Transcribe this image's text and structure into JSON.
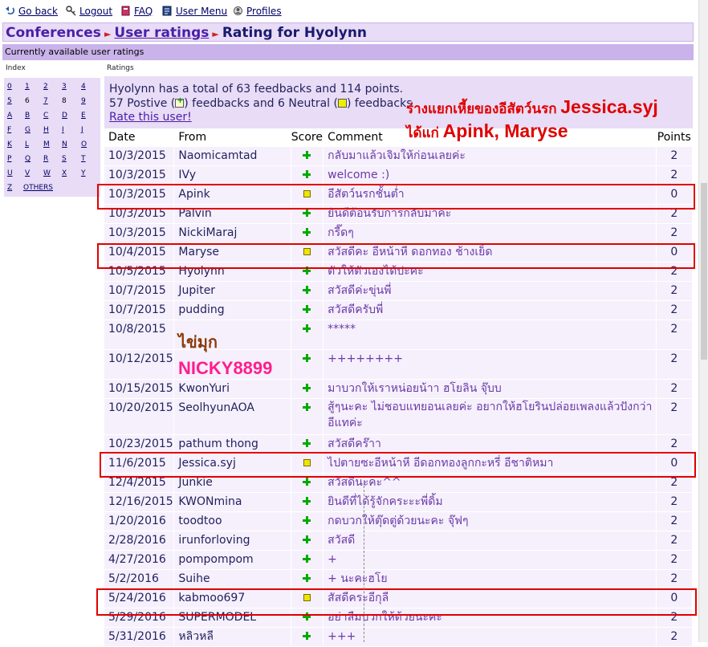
{
  "nav": {
    "go_back": "Go back",
    "logout": "Logout",
    "faq": "FAQ",
    "user_menu": "User Menu",
    "profiles": "Profiles"
  },
  "breadcrumb": {
    "conferences": "Conferences",
    "user_ratings": "User ratings",
    "current": "Rating for Hyolynn",
    "separator": "►"
  },
  "subheader": "Currently available user ratings",
  "column_labels": {
    "index": "Index",
    "ratings": "Ratings"
  },
  "index": {
    "rows": [
      [
        "0",
        "1",
        "2",
        "3",
        "4"
      ],
      [
        "5",
        "6",
        "7",
        "8",
        "9"
      ],
      [
        "A",
        "B",
        "C",
        "D",
        "E"
      ],
      [
        "F",
        "G",
        "H",
        "I",
        "J"
      ],
      [
        "K",
        "L",
        "M",
        "N",
        "O"
      ],
      [
        "P",
        "Q",
        "R",
        "S",
        "T"
      ],
      [
        "U",
        "V",
        "W",
        "X",
        "Y"
      ],
      [
        "Z",
        "OTHERS"
      ]
    ],
    "current": [
      "6",
      "8"
    ]
  },
  "summary": {
    "line1": "Hyolynn has a total of 63 feedbacks and 114 points.",
    "line2_a": "57 Postive (",
    "line2_b": ") feedbacks and 6 Neutral (",
    "line2_c": ") feedbacks",
    "rate_link": "Rate this user!"
  },
  "annotations": {
    "thai_prefix": "ร่างแยกเหี้ยของอีสัตว์นรก",
    "jessica": "Jessica.syj",
    "thai_mean": "ได้แก่",
    "names": "Apink, Maryse",
    "kaimuk": "ไข่มุก",
    "nicky": "NICKY8899"
  },
  "table": {
    "headers": {
      "date": "Date",
      "from": "From",
      "score": "Score",
      "comment": "Comment",
      "points": "Points"
    },
    "rows": [
      {
        "date": "10/3/2015",
        "from": "Naomicamtad",
        "score": "positive",
        "comment": "กลับมาแล้วเจิมให้ก่อนเลยค่ะ",
        "points": "2"
      },
      {
        "date": "10/3/2015",
        "from": "IVy",
        "score": "positive",
        "comment": "welcome :)",
        "points": "2"
      },
      {
        "date": "10/3/2015",
        "from": "Apink",
        "score": "neutral",
        "comment": "อีสัตว์นรกชั้นต่ำ",
        "points": "0"
      },
      {
        "date": "10/3/2015",
        "from": "Palvin",
        "score": "positive",
        "comment": "ยินดีต้อนรับการกลับมาค่ะ",
        "points": "2"
      },
      {
        "date": "10/3/2015",
        "from": "NickiMaraj",
        "score": "positive",
        "comment": "กรี๊ดๆ",
        "points": "2"
      },
      {
        "date": "10/4/2015",
        "from": "Maryse",
        "score": "neutral",
        "comment": "สวัสดีคะ อีหน้าหี ดอกทอง ช้างเย็ด",
        "points": "0"
      },
      {
        "date": "10/5/2015",
        "from": "Hyolynn",
        "score": "positive",
        "comment": "ตัวให้ตัวเองได้ปะคะ",
        "points": "2"
      },
      {
        "date": "10/7/2015",
        "from": "Jupiter",
        "score": "positive",
        "comment": "สวัสดีค่ะขุ่นพี่",
        "points": "2"
      },
      {
        "date": "10/7/2015",
        "from": "pudding",
        "score": "positive",
        "comment": "สวัสดีครับพี่",
        "points": "2"
      },
      {
        "date": "10/8/2015",
        "from": "",
        "score": "positive",
        "comment": "*****",
        "points": "2"
      },
      {
        "date": "10/12/2015",
        "from": "",
        "score": "positive",
        "comment": "++++++++",
        "points": "2"
      },
      {
        "date": "10/15/2015",
        "from": "KwonYuri",
        "score": "positive",
        "comment": "มาบวกให้เราหน่อยน้าา ฮโยลิน จุ๊บบ",
        "points": "2"
      },
      {
        "date": "10/20/2015",
        "from": "SeolhyunAOA",
        "score": "positive",
        "comment": "สู้ๆนะคะ ไม่ชอบแทยอนเลยค่ะ อยากให้ฮโยรินปล่อยเพลงแล้วปังกว่าอีแทค่ะ",
        "points": "2"
      },
      {
        "date": "10/23/2015",
        "from": "pathum thong",
        "score": "positive",
        "comment": "สวัสดีคร๊าา",
        "points": "2"
      },
      {
        "date": "11/6/2015",
        "from": "Jessica.syj",
        "score": "neutral",
        "comment": "ไปตายซะอีหน้าหี อีดอกทองลูกกะหรี่ อีชาติหมา",
        "points": "0"
      },
      {
        "date": "12/4/2015",
        "from": "Junkie",
        "score": "positive",
        "comment": "สวัสดีนะคะ^^",
        "points": "2"
      },
      {
        "date": "12/16/2015",
        "from": "KWONmina",
        "score": "positive",
        "comment": "ยินดีที่ได้รู้จักคระะะพี่ดิ้ม",
        "points": "2"
      },
      {
        "date": "1/20/2016",
        "from": "toodtoo",
        "score": "positive",
        "comment": "กดบวกให้ตุ๊ดตู่ด้วยนะคะ จุ๊ฟๆ",
        "points": "2"
      },
      {
        "date": "2/28/2016",
        "from": "irunforloving",
        "score": "positive",
        "comment": "สวัสดี",
        "points": "2"
      },
      {
        "date": "4/27/2016",
        "from": "pompompom",
        "score": "positive",
        "comment": "+",
        "points": "2"
      },
      {
        "date": "5/2/2016",
        "from": "Suihe",
        "score": "positive",
        "comment": "+ นะคะฮโย",
        "points": "2"
      },
      {
        "date": "5/24/2016",
        "from": "kabmoo697",
        "score": "neutral",
        "comment": "สัสดีคระอีกุลี",
        "points": "0"
      },
      {
        "date": "5/29/2016",
        "from": "SUPERMODEL",
        "score": "positive",
        "comment": "อย่าลืมบวกให้ด้วยนะคะ",
        "points": "2"
      },
      {
        "date": "5/31/2016",
        "from": "หลิวหลี",
        "score": "positive",
        "comment": "+++",
        "points": "2"
      }
    ]
  },
  "colors": {
    "highlight": "#e00000",
    "annotation_red": "#e00000",
    "annotation_pink": "#ff1e8c",
    "annotation_brown": "#8b3a0a"
  }
}
